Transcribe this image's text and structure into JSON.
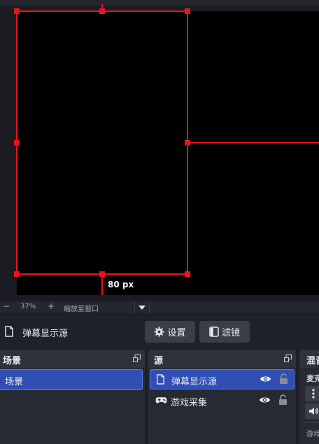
{
  "preview": {
    "transform_label": "80 px"
  },
  "zoom_bar": {
    "minus": "−",
    "zoom_level": "37%",
    "plus": "+",
    "fit_label": "缩放至窗口"
  },
  "source_toolbar": {
    "selected_source": "弹幕显示源",
    "settings_label": "设置",
    "filters_label": "滤镜"
  },
  "scenes": {
    "title": "场景",
    "items": [
      {
        "label": "场景"
      }
    ]
  },
  "sources": {
    "title": "源",
    "items": [
      {
        "label": "弹幕显示源",
        "icon": "file-icon",
        "selected": true
      },
      {
        "label": "游戏采集",
        "icon": "gamepad-icon",
        "selected": false
      }
    ]
  },
  "mixer": {
    "title": "混音",
    "channel_1": "麦克",
    "channel_2": "游戏"
  },
  "colors": {
    "accent": "#2f4fb4",
    "selection": "#e8161b",
    "dock_bg": "#272a33"
  }
}
